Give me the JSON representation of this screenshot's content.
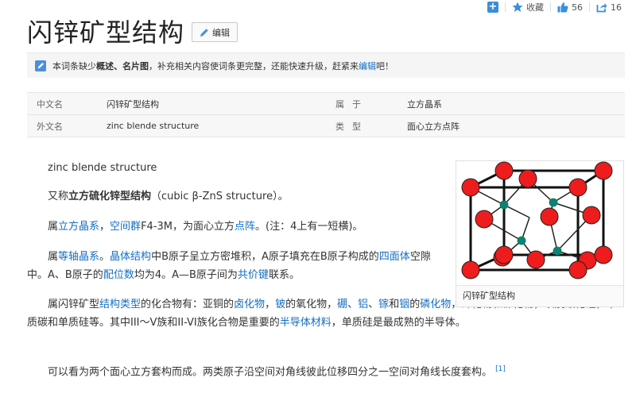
{
  "toolbar": {
    "collect_label": "收藏",
    "like_count": "56",
    "share_count": "16"
  },
  "page": {
    "title": "闪锌矿型结构",
    "edit_label": "编辑"
  },
  "notice": {
    "prefix": "本词条缺少",
    "missing": "概述、名片图",
    "middle": "，补充相关内容使词条更完整，还能快速升级，赶紧来",
    "link": "编辑",
    "suffix": "吧！"
  },
  "infobox": {
    "rows": [
      {
        "k1": "中文名",
        "v1": "闪锌矿型结构",
        "k2": "属于",
        "v2": "立方晶系"
      },
      {
        "k1": "外文名",
        "v1": "zinc blende structure",
        "k2": "类型",
        "v2": "面心立方点阵"
      }
    ]
  },
  "content": {
    "p1": "zinc blende structure",
    "p2_a": "又称",
    "p2_b": "立方硫化锌型结构",
    "p2_c": "（cubic β-ZnS structure）。",
    "p3_a": "属",
    "p3_link1": "立方晶系",
    "p3_sep": "，",
    "p3_link2": "空间群",
    "p3_b": "F4-3M，为面心立方",
    "p3_link3": "点阵",
    "p3_c": "。(注：4上有一短横)。",
    "p4_a": "属",
    "p4_link1": "等轴晶系",
    "p4_sep": "。",
    "p4_link2": "晶体结构",
    "p4_b": "中B原子呈立方密堆积，A原子填充在B原子构成的",
    "p4_link3": "四面体",
    "p4_c": "空隙中。A、B原子的",
    "p4_link4": "配位数",
    "p4_d": "均为4。A—B原子间为",
    "p4_link5": "共价键",
    "p4_e": "联系。",
    "p5_a": "属闪锌矿型",
    "p5_link1": "结构类型",
    "p5_b": "的化合物有：亚铜的",
    "p5_link2": "卤化物",
    "p5_c": "，",
    "p5_link3": "铍",
    "p5_d": "的氧化物，",
    "p5_link4": "硼",
    "p5_e": "、",
    "p5_link5": "铝",
    "p5_f": "、",
    "p5_link6": "镓",
    "p5_g": "和",
    "p5_link7": "铟",
    "p5_h": "的",
    "p5_link8": "磷化物",
    "p5_i": "，",
    "p5_link9": "砷化物",
    "p5_j": "和",
    "p5_link10": "锑化物",
    "p5_k": "，以及",
    "p5_link11": "碳化硅",
    "p5_l": "，单质碳和单质硅等。其中III～V族和II-VI族化合物是重要的",
    "p5_link12": "半导体材料",
    "p5_m": "，单质硅是最成熟的半导体。",
    "p6": "可以看为两个面心立方套构而成。两类原子沿空间对角线彼此位移四分之一空间对角线长度套构。",
    "p6_ref": "[1]"
  },
  "figure": {
    "caption": "闪锌矿型结构"
  },
  "colors": {
    "link": "#136ec2",
    "atom_large": "#ee1c1c",
    "atom_small": "#0b8080",
    "accent": "#3a8ed8"
  }
}
